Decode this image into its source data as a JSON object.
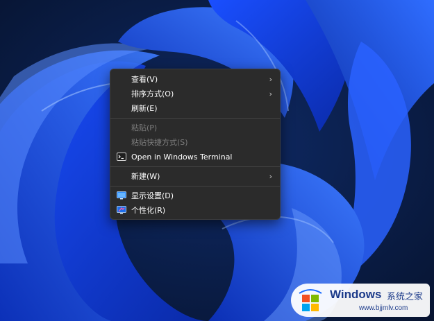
{
  "menu": {
    "items": [
      {
        "label": "查看(V)",
        "has_submenu": true
      },
      {
        "label": "排序方式(O)",
        "has_submenu": true
      },
      {
        "label": "刷新(E)"
      },
      {
        "label": "粘贴(P)",
        "disabled": true
      },
      {
        "label": "粘贴快捷方式(S)",
        "disabled": true
      },
      {
        "label": "Open in Windows Terminal",
        "icon": "terminal-icon"
      },
      {
        "label": "新建(W)",
        "has_submenu": true
      },
      {
        "label": "显示设置(D)",
        "icon": "display-settings-icon"
      },
      {
        "label": "个性化(R)",
        "icon": "personalize-icon"
      }
    ],
    "submenu_glyph": "›"
  },
  "watermark": {
    "title": "Windows",
    "subtitle": "系统之家",
    "url": "www.bjjmlv.com"
  },
  "colors": {
    "menu_bg": "#2b2b2b",
    "wallpaper_blue": "#1f5cff",
    "watermark_text": "#1b3a8a"
  }
}
